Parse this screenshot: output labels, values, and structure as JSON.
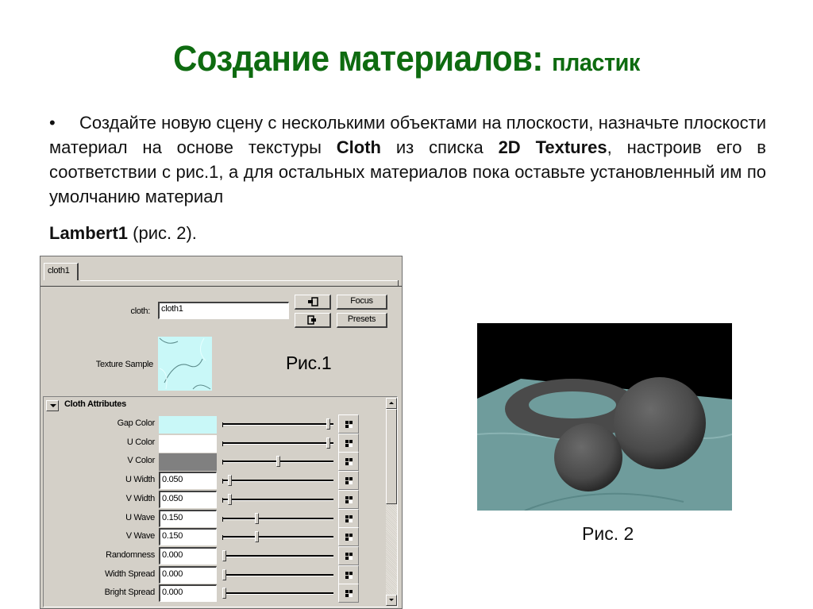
{
  "slide": {
    "title_main": "Создание материалов:",
    "title_sub": "пластик",
    "bullet": "•",
    "paragraph": {
      "part1": "Создайте новую сцену с несколькими объектами на плоскости, назначьте плоскости материал на основе текстуры ",
      "bold1": "Cloth",
      "part2": " из списка ",
      "bold2": "2D Textures",
      "part3": ", настроив его в соответствии с рис.1, а для остальных материалов пока оставьте установленный им по умолчанию материал",
      "bold3": "Lambert1",
      "part4": " (рис. 2)."
    },
    "figure1_caption": "Рис.1",
    "figure2_caption": "Рис. 2"
  },
  "panel": {
    "tab_label": "cloth1",
    "name_label": "cloth:",
    "name_value": "cloth1",
    "buttons": {
      "input_icon": "input-connection-icon",
      "output_icon": "output-connection-icon",
      "focus": "Focus",
      "presets": "Presets"
    },
    "texture_sample_label": "Texture Sample",
    "section_title": "Cloth Attributes",
    "attributes": [
      {
        "label": "Gap Color",
        "type": "color",
        "color": "#c9f8f8",
        "slider": 0.97
      },
      {
        "label": "U Color",
        "type": "color",
        "color": "#ffffff",
        "slider": 0.97
      },
      {
        "label": "V Color",
        "type": "color",
        "color": "#808080",
        "slider": 0.5
      },
      {
        "label": "U Width",
        "type": "number",
        "value": "0.050",
        "slider": 0.05
      },
      {
        "label": "V Width",
        "type": "number",
        "value": "0.050",
        "slider": 0.05
      },
      {
        "label": "U Wave",
        "type": "number",
        "value": "0.150",
        "slider": 0.3
      },
      {
        "label": "V Wave",
        "type": "number",
        "value": "0.150",
        "slider": 0.3
      },
      {
        "label": "Randomness",
        "type": "number",
        "value": "0.000",
        "slider": 0.0
      },
      {
        "label": "Width Spread",
        "type": "number",
        "value": "0.000",
        "slider": 0.0
      },
      {
        "label": "Bright Spread",
        "type": "number",
        "value": "0.000",
        "slider": 0.0
      }
    ]
  }
}
